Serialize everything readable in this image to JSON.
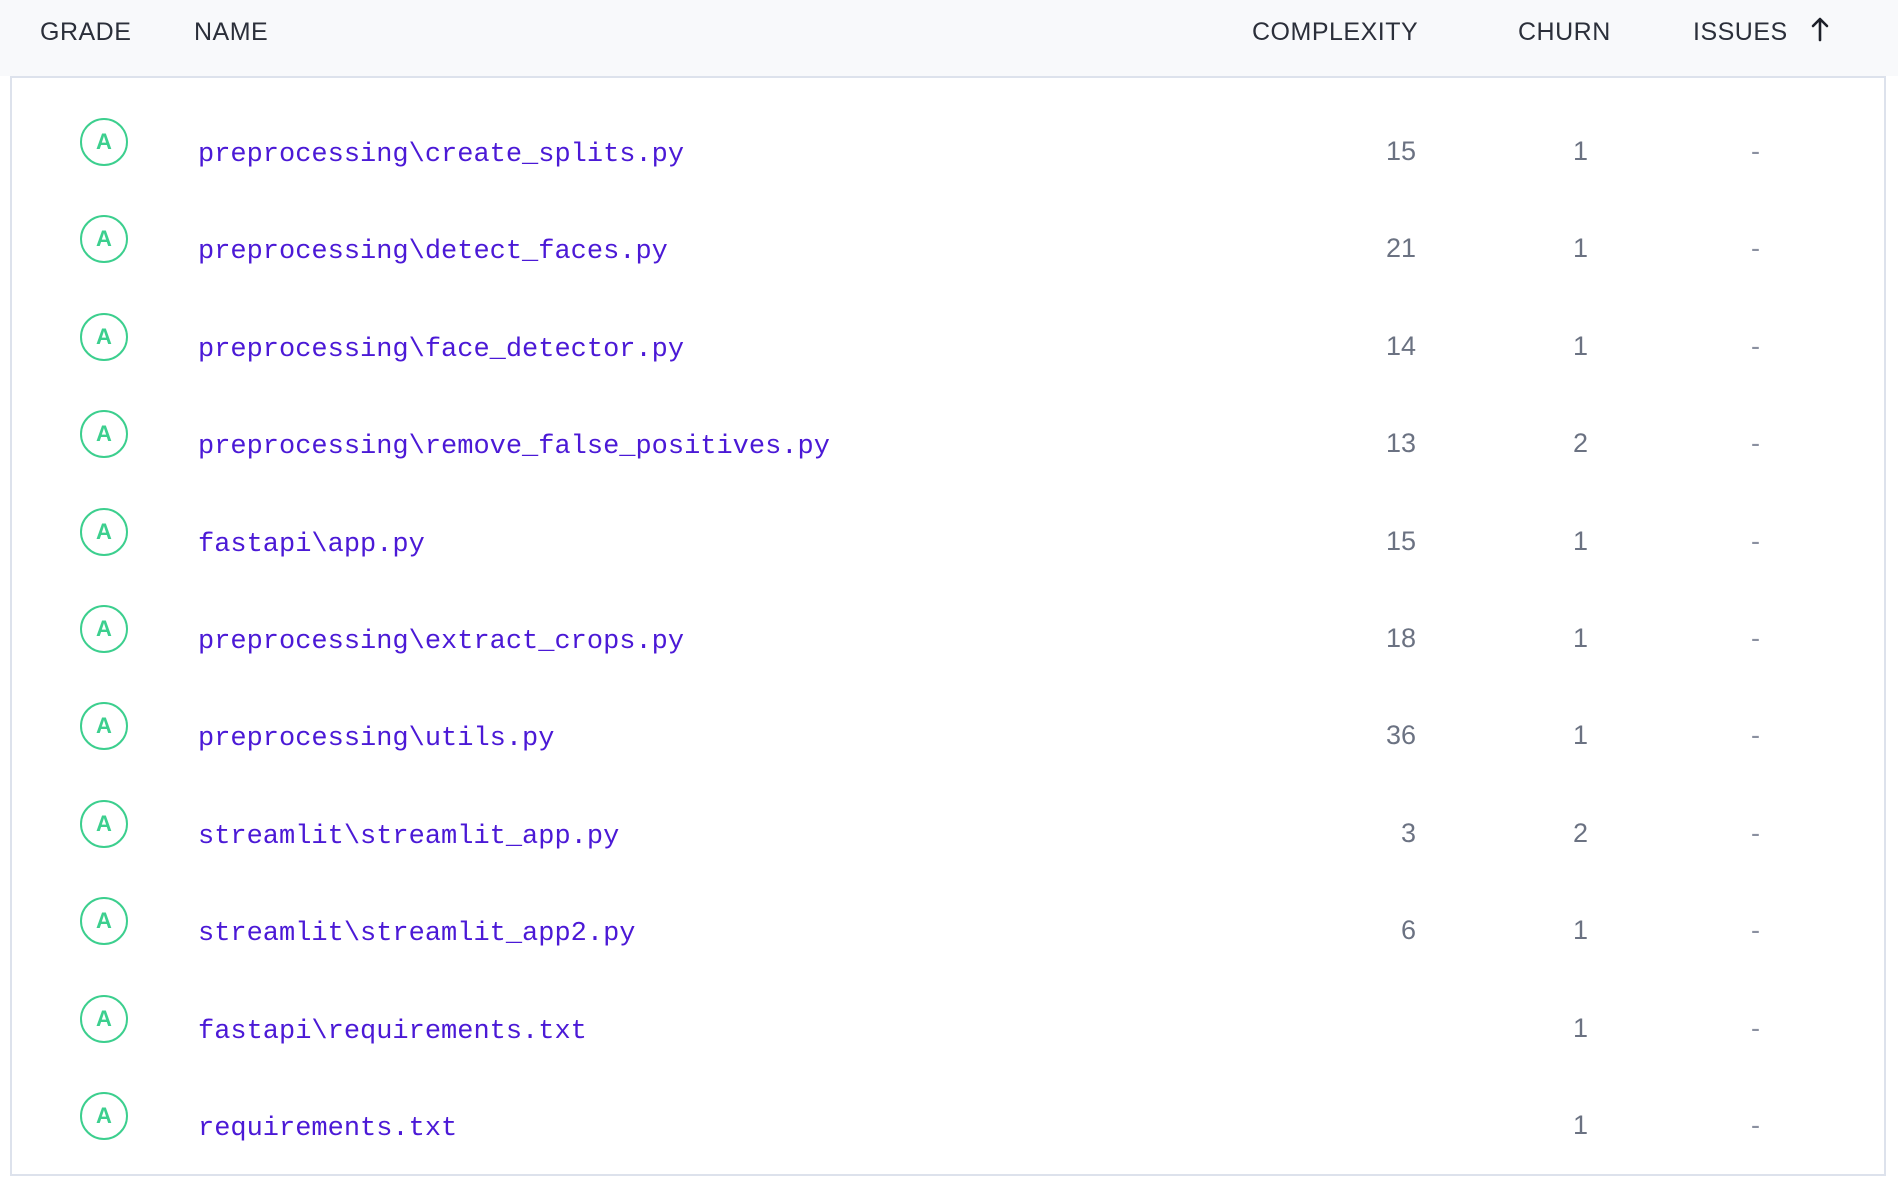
{
  "columns": {
    "grade": "GRADE",
    "name": "NAME",
    "complexity": "COMPLEXITY",
    "churn": "CHURN",
    "issues": "ISSUES",
    "issues_sort_icon": "arrow-up-icon"
  },
  "colors": {
    "grade_a": "#3ccf8e",
    "file_link": "#4b19d6",
    "header_bg": "#f8f9fb"
  },
  "rows": [
    {
      "grade": "A",
      "name": "preprocessing\\create_splits.py",
      "complexity": "15",
      "churn": "1",
      "issues": "-"
    },
    {
      "grade": "A",
      "name": "preprocessing\\detect_faces.py",
      "complexity": "21",
      "churn": "1",
      "issues": "-"
    },
    {
      "grade": "A",
      "name": "preprocessing\\face_detector.py",
      "complexity": "14",
      "churn": "1",
      "issues": "-"
    },
    {
      "grade": "A",
      "name": "preprocessing\\remove_false_positives.py",
      "complexity": "13",
      "churn": "2",
      "issues": "-"
    },
    {
      "grade": "A",
      "name": "fastapi\\app.py",
      "complexity": "15",
      "churn": "1",
      "issues": "-"
    },
    {
      "grade": "A",
      "name": "preprocessing\\extract_crops.py",
      "complexity": "18",
      "churn": "1",
      "issues": "-"
    },
    {
      "grade": "A",
      "name": "preprocessing\\utils.py",
      "complexity": "36",
      "churn": "1",
      "issues": "-"
    },
    {
      "grade": "A",
      "name": "streamlit\\streamlit_app.py",
      "complexity": "3",
      "churn": "2",
      "issues": "-"
    },
    {
      "grade": "A",
      "name": "streamlit\\streamlit_app2.py",
      "complexity": "6",
      "churn": "1",
      "issues": "-"
    },
    {
      "grade": "A",
      "name": "fastapi\\requirements.txt",
      "complexity": "",
      "churn": "1",
      "issues": "-"
    },
    {
      "grade": "A",
      "name": "requirements.txt",
      "complexity": "",
      "churn": "1",
      "issues": "-"
    }
  ]
}
